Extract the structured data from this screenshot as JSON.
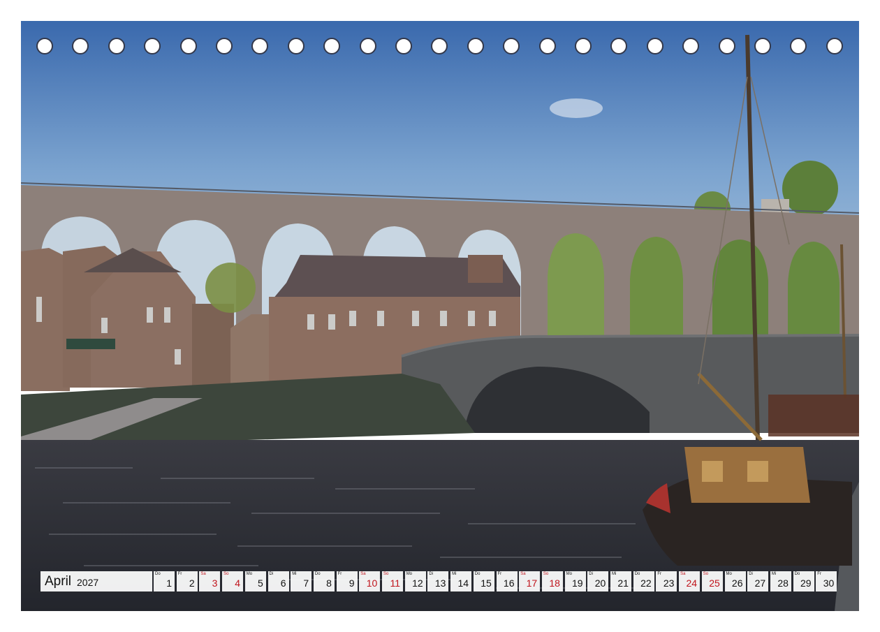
{
  "calendar": {
    "month": "April",
    "year": "2027",
    "days": [
      {
        "abbr": "Do",
        "num": "1",
        "weekend": false
      },
      {
        "abbr": "Fr",
        "num": "2",
        "weekend": false
      },
      {
        "abbr": "Sa",
        "num": "3",
        "weekend": true
      },
      {
        "abbr": "So",
        "num": "4",
        "weekend": true
      },
      {
        "abbr": "Mo",
        "num": "5",
        "weekend": false
      },
      {
        "abbr": "Di",
        "num": "6",
        "weekend": false
      },
      {
        "abbr": "Mi",
        "num": "7",
        "weekend": false
      },
      {
        "abbr": "Do",
        "num": "8",
        "weekend": false
      },
      {
        "abbr": "Fr",
        "num": "9",
        "weekend": false
      },
      {
        "abbr": "Sa",
        "num": "10",
        "weekend": true
      },
      {
        "abbr": "So",
        "num": "11",
        "weekend": true
      },
      {
        "abbr": "Mo",
        "num": "12",
        "weekend": false
      },
      {
        "abbr": "Di",
        "num": "13",
        "weekend": false
      },
      {
        "abbr": "Mi",
        "num": "14",
        "weekend": false
      },
      {
        "abbr": "Do",
        "num": "15",
        "weekend": false
      },
      {
        "abbr": "Fr",
        "num": "16",
        "weekend": false
      },
      {
        "abbr": "Sa",
        "num": "17",
        "weekend": true
      },
      {
        "abbr": "So",
        "num": "18",
        "weekend": true
      },
      {
        "abbr": "Mo",
        "num": "19",
        "weekend": false
      },
      {
        "abbr": "Di",
        "num": "20",
        "weekend": false
      },
      {
        "abbr": "Mi",
        "num": "21",
        "weekend": false
      },
      {
        "abbr": "Do",
        "num": "22",
        "weekend": false
      },
      {
        "abbr": "Fr",
        "num": "23",
        "weekend": false
      },
      {
        "abbr": "Sa",
        "num": "24",
        "weekend": true
      },
      {
        "abbr": "So",
        "num": "25",
        "weekend": true
      },
      {
        "abbr": "Mo",
        "num": "26",
        "weekend": false
      },
      {
        "abbr": "Di",
        "num": "27",
        "weekend": false
      },
      {
        "abbr": "Mi",
        "num": "28",
        "weekend": false
      },
      {
        "abbr": "Do",
        "num": "29",
        "weekend": false
      },
      {
        "abbr": "Fr",
        "num": "30",
        "weekend": false
      }
    ]
  },
  "binding": {
    "hole_count": 23
  },
  "colors": {
    "weekend": "#c0141c",
    "sky": "#3f6fb3",
    "water": "#2b2d36",
    "stone": "#7d6f66",
    "hole_border": "#33384a"
  }
}
